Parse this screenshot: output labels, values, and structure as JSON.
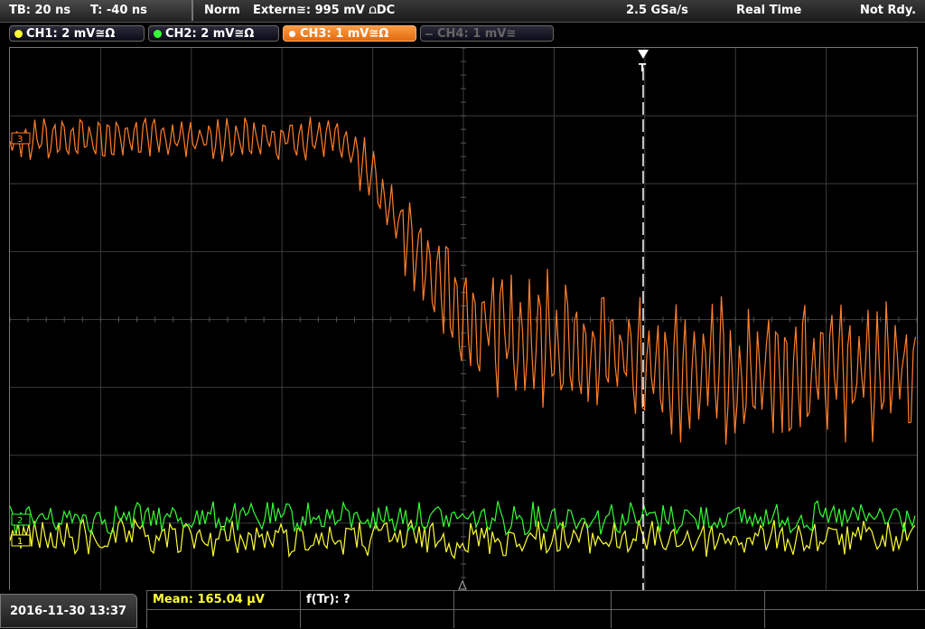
{
  "header": {
    "timebase": "TB: 20 ns",
    "trigger_time": "T: -40 ns",
    "trigger_mode": "Norm",
    "trigger_source": "Extern≅: 995 mV ⩍DC",
    "sample_rate": "2.5 GSa/s",
    "acq_mode": "Real Time",
    "status": "Not Rdy."
  },
  "channels": [
    {
      "label": "CH1: 2 mV≅Ω",
      "color": "#ffff33"
    },
    {
      "label": "CH2: 2 mV≅Ω",
      "color": "#33ff33"
    },
    {
      "label": "CH3: 1 mV≅Ω",
      "color": "#ff7f2a"
    },
    {
      "label": "CH4: 1 mV≅",
      "color": "#555555"
    }
  ],
  "markers": {
    "ch3": "3",
    "ch2": "2",
    "ch1": "1",
    "trigger": "T"
  },
  "footer": {
    "datetime": "2016-11-30 13:37",
    "measurement_mean": "Mean: 165.04 µV",
    "measurement_ftr": "f(Tr): ?"
  },
  "colors": {
    "grid": "#3c3c3c",
    "trace_ch1": "#ffff33",
    "trace_ch2": "#33ff33",
    "trace_ch3": "#ff7f2a"
  }
}
